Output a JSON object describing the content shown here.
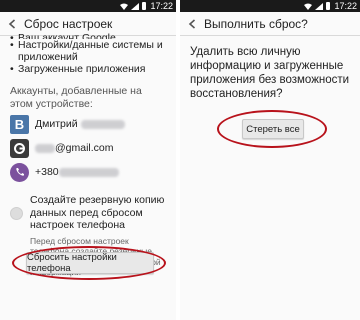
{
  "colors": {
    "accent_oval": "#b8121b",
    "vk": "#4a76a8",
    "viber": "#7b519d",
    "statusbar": "#1a1a1a"
  },
  "left": {
    "status_time": "17:22",
    "title": "Сброс настроек",
    "bullets": [
      "Ваш аккаунт Google",
      "Настройки/данные системы и приложений",
      "Загруженные приложения"
    ],
    "accounts_label": "Аккаунты, добавленные на этом устройстве:",
    "accounts": [
      {
        "icon": "vk-icon",
        "letter": "B",
        "text": "Дмитрий"
      },
      {
        "icon": "google-icon",
        "letter": "g",
        "text": "@gmail.com"
      },
      {
        "icon": "viber-icon",
        "letter": "",
        "text": "+380"
      }
    ],
    "backup_label": "Создайте резервную копию данных перед сбросом настроек телефона",
    "backup_hint": "Перед сбросом настроек телефона создайте резервные копии контактов и другой важной информации",
    "reset_button": "Сбросить настройки телефона"
  },
  "right": {
    "status_time": "17:22",
    "title": "Выполнить сброс?",
    "confirm_text": "Удалить всю личную информацию и загруженные приложения без возможности восстановления?",
    "erase_button": "Стереть все"
  }
}
